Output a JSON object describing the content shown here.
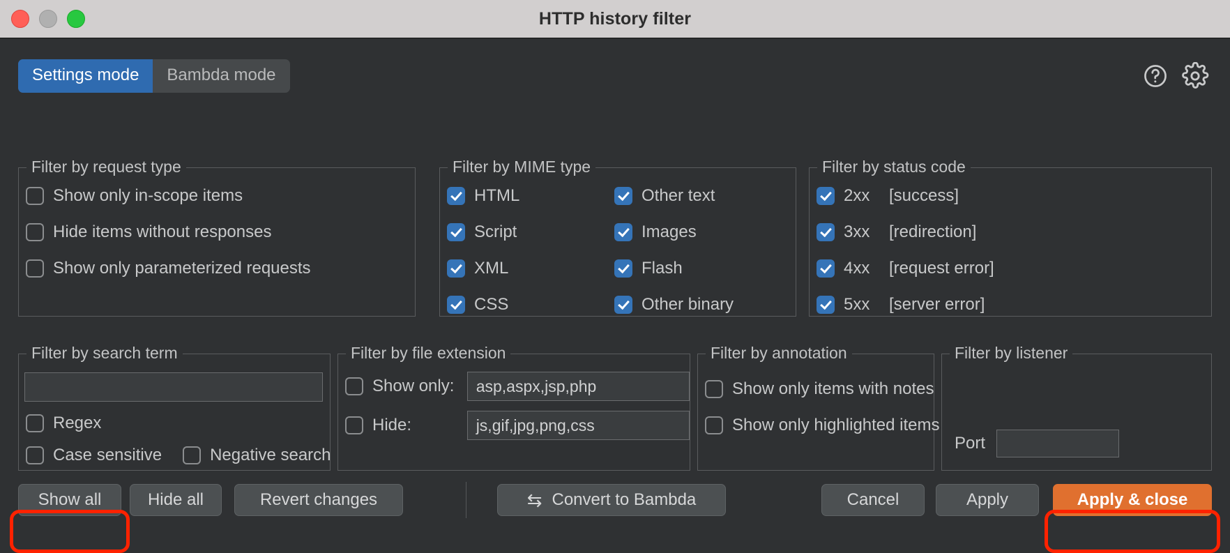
{
  "window": {
    "title": "HTTP history filter",
    "traffic_lights": [
      "close",
      "minimize",
      "zoom"
    ]
  },
  "modes": {
    "settings_label": "Settings mode",
    "bambda_label": "Bambda mode",
    "active": "Settings mode"
  },
  "header_icons": {
    "help": "help-circle-icon",
    "settings": "gear-icon"
  },
  "groups": {
    "request_type": {
      "legend": "Filter by request type",
      "items": [
        {
          "label": "Show only in-scope items",
          "checked": false
        },
        {
          "label": "Hide items without responses",
          "checked": false
        },
        {
          "label": "Show only parameterized requests",
          "checked": false
        }
      ]
    },
    "mime_type": {
      "legend": "Filter by MIME type",
      "left": [
        {
          "label": "HTML",
          "checked": true
        },
        {
          "label": "Script",
          "checked": true
        },
        {
          "label": "XML",
          "checked": true
        },
        {
          "label": "CSS",
          "checked": true
        }
      ],
      "right": [
        {
          "label": "Other text",
          "checked": true
        },
        {
          "label": "Images",
          "checked": true
        },
        {
          "label": "Flash",
          "checked": true
        },
        {
          "label": "Other binary",
          "checked": true
        }
      ]
    },
    "status_code": {
      "legend": "Filter by status code",
      "items": [
        {
          "code": "2xx",
          "desc": "[success]",
          "checked": true
        },
        {
          "code": "3xx",
          "desc": "[redirection]",
          "checked": true
        },
        {
          "code": "4xx",
          "desc": "[request error]",
          "checked": true
        },
        {
          "code": "5xx",
          "desc": "[server error]",
          "checked": true
        }
      ]
    },
    "search_term": {
      "legend": "Filter by search term",
      "input_value": "",
      "input_placeholder": "",
      "options": [
        {
          "label": "Regex",
          "checked": false
        },
        {
          "label": "Case sensitive",
          "checked": false
        },
        {
          "label": "Negative search",
          "checked": false
        }
      ]
    },
    "file_extension": {
      "legend": "Filter by file extension",
      "rows": [
        {
          "label": "Show only:",
          "checked": false,
          "value": "asp,aspx,jsp,php"
        },
        {
          "label": "Hide:",
          "checked": false,
          "value": "js,gif,jpg,png,css"
        }
      ]
    },
    "annotation": {
      "legend": "Filter by annotation",
      "items": [
        {
          "label": "Show only items with notes",
          "checked": false
        },
        {
          "label": "Show only highlighted items",
          "checked": false
        }
      ]
    },
    "listener": {
      "legend": "Filter by listener",
      "port_label": "Port",
      "port_value": ""
    }
  },
  "buttons": {
    "show_all": "Show all",
    "hide_all": "Hide all",
    "revert_changes": "Revert changes",
    "convert_to_bambda": "Convert to Bambda",
    "convert_icon": "⇆",
    "cancel": "Cancel",
    "apply": "Apply",
    "apply_close": "Apply & close"
  },
  "colors": {
    "accent_blue": "#3574B8",
    "primary_orange": "#E0702F",
    "annotation_red": "#FF2200",
    "dialog_bg": "#2F3133",
    "titlebar_bg": "#D2CFCF"
  },
  "annotations": [
    {
      "target": "Show all"
    },
    {
      "target": "Apply & close"
    }
  ]
}
